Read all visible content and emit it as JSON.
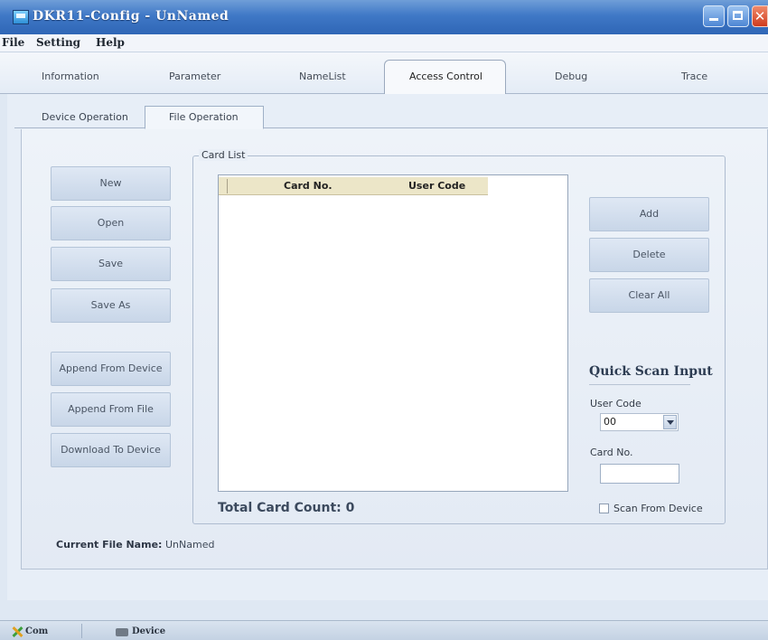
{
  "window": {
    "title": "DKR11-Config - UnNamed",
    "close_glyph": "✕"
  },
  "menu": {
    "file": "File",
    "setting": "Setting",
    "help": "Help"
  },
  "tabs": [
    "Information",
    "Parameter",
    "NameList",
    "Access Control",
    "Debug",
    "Trace"
  ],
  "subtabs": [
    "Device Operation",
    "File Operation"
  ],
  "left_buttons": {
    "new": "New",
    "open": "Open",
    "save": "Save",
    "save_as": "Save As",
    "append_from_device": "Append From Device",
    "append_from_file": "Append From File",
    "download_to_device": "Download To Device"
  },
  "card_list": {
    "group_label": "Card List",
    "columns": [
      "Card No.",
      "User Code"
    ],
    "rows": [],
    "total_label": "Total Card Count:",
    "total_value": "0"
  },
  "right_buttons": {
    "add": "Add",
    "delete": "Delete",
    "clear_all": "Clear All"
  },
  "quick_scan": {
    "title": "Quick Scan Input",
    "user_code_label": "User Code",
    "user_code_value": "00",
    "card_no_label": "Card No.",
    "card_no_value": "",
    "scan_from_device_label": "Scan From Device",
    "scan_from_device_checked": false
  },
  "current_file": {
    "label": "Current File Name:",
    "value": "UnNamed"
  },
  "status": {
    "com": "Com",
    "device": "Device"
  },
  "icons": {
    "app": "app-icon",
    "minimize": "minimize-icon",
    "maximize": "maximize-icon",
    "close": "close-icon",
    "com": "com-port-icon",
    "device": "device-icon",
    "dropdown": "chevron-down-icon"
  }
}
